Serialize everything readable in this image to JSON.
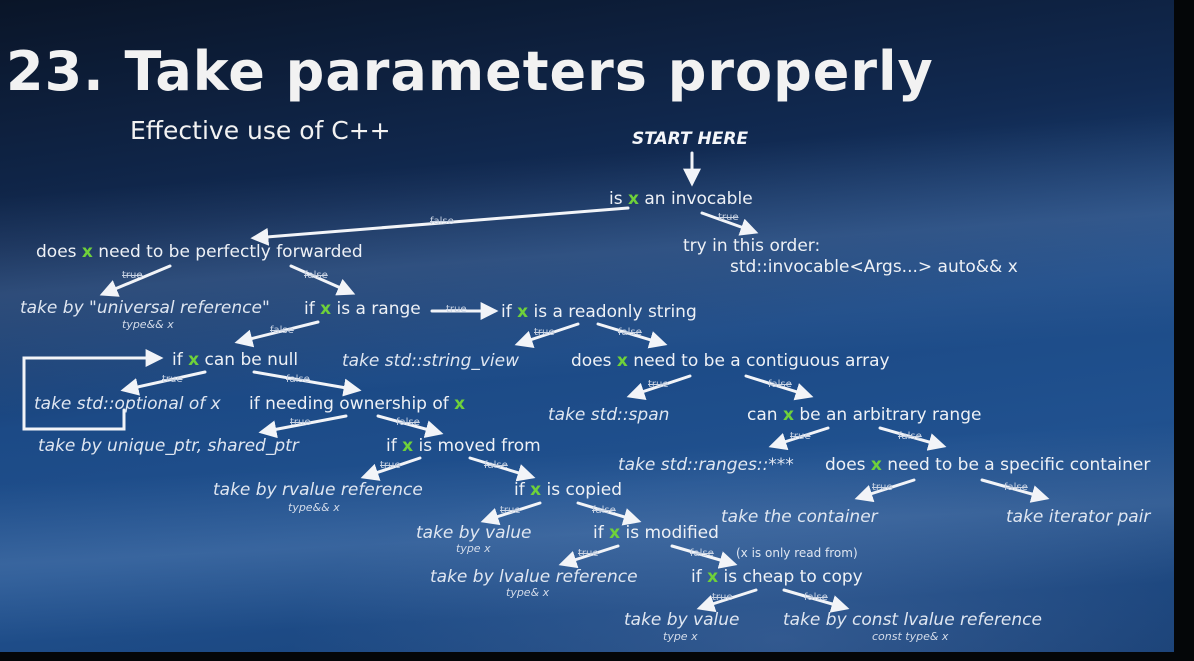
{
  "slide": {
    "title": "23. Take parameters properly",
    "subtitle": "Effective use of C++",
    "start_label": "START HERE"
  },
  "nodes": {
    "invocable": {
      "pre": "is ",
      "var": "x",
      "post": " an invocable"
    },
    "forwarded": {
      "pre": "does ",
      "var": "x",
      "post": " need to be perfectly forwarded"
    },
    "try_order": "try in this order:",
    "try_order_detail": "std::invocable<Args...> auto&& x",
    "universal_ref": "take by \"universal reference\"",
    "universal_ref_type": "type&& x",
    "is_range": {
      "pre": "if ",
      "var": "x",
      "post": " is a range"
    },
    "readonly_string": {
      "pre": "if ",
      "var": "x",
      "post": " is a readonly string"
    },
    "can_be_null": {
      "pre": "if ",
      "var": "x",
      "post": " can be null"
    },
    "string_view": "take std::string_view",
    "contiguous": {
      "pre": "does ",
      "var": "x",
      "post": " need to be a contiguous array"
    },
    "optional": "take std::optional of x",
    "needing_ownership": {
      "pre": "if needing ownership of ",
      "var": "x",
      "post": ""
    },
    "span": "take std::span",
    "arbitrary_range": {
      "pre": "can ",
      "var": "x",
      "post": " be an arbitrary range"
    },
    "unique_ptr": "take by unique_ptr, shared_ptr",
    "moved_from": {
      "pre": "if ",
      "var": "x",
      "post": " is moved from"
    },
    "ranges": "take std::ranges::***",
    "specific_container": {
      "pre": "does ",
      "var": "x",
      "post": " need to be a specific container"
    },
    "rvalue_ref": "take by rvalue reference",
    "rvalue_ref_type": "type&& x",
    "is_copied": {
      "pre": "if ",
      "var": "x",
      "post": " is copied"
    },
    "take_container": "take the container",
    "iterator_pair": "take iterator pair",
    "by_value_1": "take by value",
    "by_value_1_type": "type x",
    "is_modified": {
      "pre": "if ",
      "var": "x",
      "post": " is modified"
    },
    "lvalue_ref": "take by lvalue reference",
    "lvalue_ref_type": "type& x",
    "cheap_to_copy": {
      "pre": "if ",
      "var": "x",
      "post": " is cheap to copy"
    },
    "only_read": "(x is only read from)",
    "by_value_2": "take by value",
    "by_value_2_type": "type x",
    "const_lvalue_ref": "take by const lvalue reference",
    "const_lvalue_ref_type": "const type& x"
  },
  "edge_labels": {
    "true": "true",
    "false": "false"
  },
  "colors": {
    "var_accent": "#6fd13a",
    "text": "#eef1f6",
    "background": "#1c4a86"
  }
}
